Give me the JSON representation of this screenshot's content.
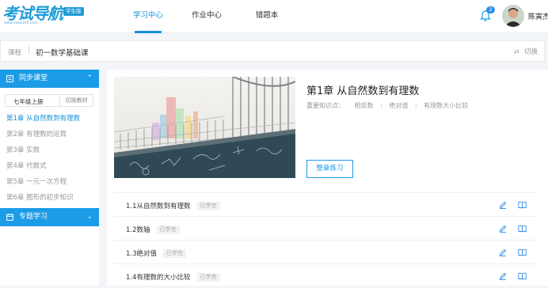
{
  "header": {
    "logo_text": "考试导航",
    "logo_sub": "www.yoka100.com",
    "logo_badge": "学生版",
    "nav": [
      {
        "label": "学习中心",
        "active": true
      },
      {
        "label": "作业中心",
        "active": false
      },
      {
        "label": "错题本",
        "active": false
      }
    ],
    "notification_count": "2",
    "username": "陈寅杰"
  },
  "breadcrumb": {
    "home": "课程",
    "separator": "|",
    "current": "初一数学基础课",
    "switch_label": "切换",
    "switch_icon": "swap-arrows-icon"
  },
  "sidebar": {
    "section1": {
      "label": "同步课堂",
      "icon": "book-icon",
      "expanded": true
    },
    "grade": {
      "value": "七年级上册",
      "switch_label": "切换教材"
    },
    "chapters": [
      {
        "label": "第1章 从自然数到有理数",
        "active": true
      },
      {
        "label": "第2章 有理数的运算",
        "active": false
      },
      {
        "label": "第3章 实数",
        "active": false
      },
      {
        "label": "第4章 代数式",
        "active": false
      },
      {
        "label": "第5章 一元一次方程",
        "active": false
      },
      {
        "label": "第6章 图形的初步知识",
        "active": false
      }
    ],
    "section2": {
      "label": "专题学习",
      "icon": "calendar-icon",
      "expanded": false
    }
  },
  "chapter": {
    "title": "第1章 从自然数到有理数",
    "knowledge_label": "重要知识点：",
    "knowledge_points": [
      "相反数",
      "绝对值",
      "有理数大小比较"
    ],
    "practice_button": "整章练习"
  },
  "sections": [
    {
      "title": "1.1从自然数到有理数",
      "status": "已学完"
    },
    {
      "title": "1.2数轴",
      "status": "已学完"
    },
    {
      "title": "1.3绝对值",
      "status": "已学完"
    },
    {
      "title": "1.4有理数的大小比较",
      "status": "已学完"
    }
  ],
  "colors": {
    "accent": "#1c9be6",
    "active_text": "#1890d8",
    "page_bg": "#f3f5f8"
  }
}
